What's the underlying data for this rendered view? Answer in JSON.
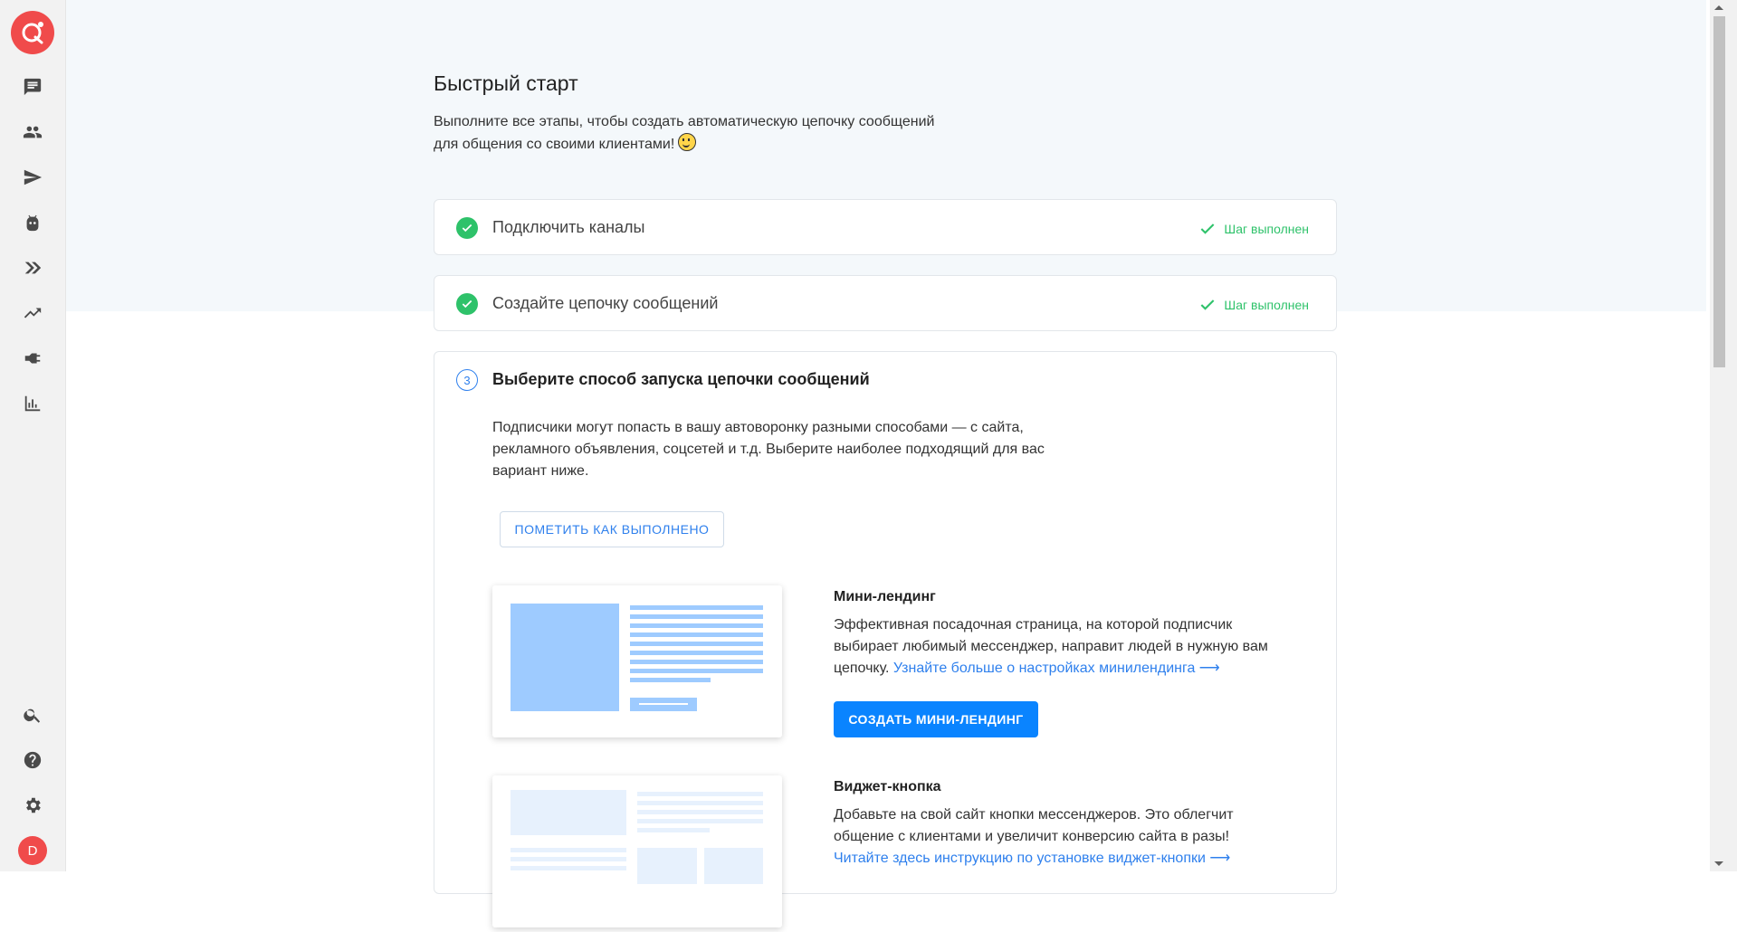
{
  "sidebar": {
    "logo": "logo-icon",
    "items": [
      {
        "icon": "chat-icon"
      },
      {
        "icon": "users-icon"
      },
      {
        "icon": "send-icon"
      },
      {
        "icon": "bot-icon"
      },
      {
        "icon": "autofunnel-icon"
      },
      {
        "icon": "trending-icon"
      },
      {
        "icon": "integrations-icon"
      },
      {
        "icon": "analytics-icon"
      }
    ],
    "bottom": [
      {
        "icon": "search-icon"
      },
      {
        "icon": "help-icon"
      },
      {
        "icon": "settings-icon"
      }
    ],
    "avatar_letter": "D"
  },
  "page": {
    "title": "Быстрый старт",
    "subtitle": "Выполните все этапы, чтобы создать автоматическую цепочку сообщений для общения со своими клиентами!"
  },
  "steps": [
    {
      "title": "Подключить каналы",
      "status": "Шаг выполнен"
    },
    {
      "title": "Создайте цепочку сообщений",
      "status": "Шаг выполнен"
    }
  ],
  "step3": {
    "number": "3",
    "title": "Выберите способ запуска цепочки сообщений",
    "description": "Подписчики могут попасть в вашу автоворонку разными способами — с сайта, рекламного объявления, соцсетей и т.д. Выберите наиболее подходящий для вас вариант ниже.",
    "mark_done_label": "ПОМЕТИТЬ КАК ВЫПОЛНЕНО",
    "options": [
      {
        "title": "Мини-лендинг",
        "description": "Эффективная посадочная страница, на которой подписчик выбирает любимый мессенджер, направит людей в нужную вам цепочку.",
        "link": "Узнайте больше о настройках минилендинга ⟶",
        "button": "СОЗДАТЬ МИНИ-ЛЕНДИНГ"
      },
      {
        "title": "Виджет-кнопка",
        "description": "Добавьте на свой сайт кнопки мессенджеров. Это облегчит общение с клиентами и увеличит конверсию сайта в разы!",
        "link": "Читайте здесь инструкцию по установке виджет-кнопки ⟶"
      }
    ]
  },
  "colors": {
    "accent": "#0a84ff",
    "success": "#2ec26a",
    "brand": "#f04b4b"
  }
}
